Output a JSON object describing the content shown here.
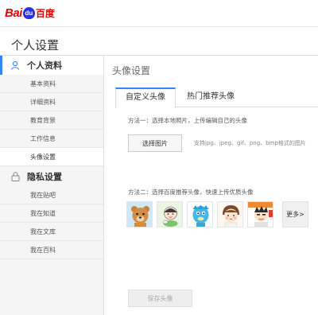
{
  "brand": {
    "logo_latin": "Bai",
    "logo_paw": "du",
    "logo_cn": "百度"
  },
  "page": {
    "title": "个人设置"
  },
  "sidebar": {
    "sections": [
      {
        "label": "个人资料",
        "icon": "user-icon",
        "active": true
      },
      {
        "label": "隐私设置",
        "icon": "lock-icon",
        "active": false
      }
    ],
    "profile_items": [
      "基本资料",
      "详细资料",
      "教育背景",
      "工作信息",
      "头像设置"
    ],
    "privacy_items": [
      "我在贴吧",
      "我在知道",
      "我在文库",
      "我在百科"
    ],
    "current_item": "头像设置"
  },
  "main": {
    "title": "头像设置",
    "tabs": [
      {
        "label": "自定义头像",
        "active": true
      },
      {
        "label": "热门推荐头像",
        "active": false
      }
    ],
    "method1": "方法一：选择本地照片，上传编辑自己的头像",
    "upload_button": "选择图片",
    "upload_hint": "支持jpg、jpeg、gif、png、bmp格式的图片",
    "method2": "方法二：选择百度推荐头像，快速上传优质头像",
    "avatars": [
      "bear-avatar",
      "dumpling-girl-avatar",
      "cartoon-fish-avatar",
      "cartoon-boy-avatar",
      "cartoon-man-avatar"
    ],
    "more_button": "更多>",
    "save_button": "保存头像"
  },
  "colors": {
    "accent": "#3385ff",
    "brand_red": "#e10601",
    "brand_blue": "#2932e1"
  }
}
